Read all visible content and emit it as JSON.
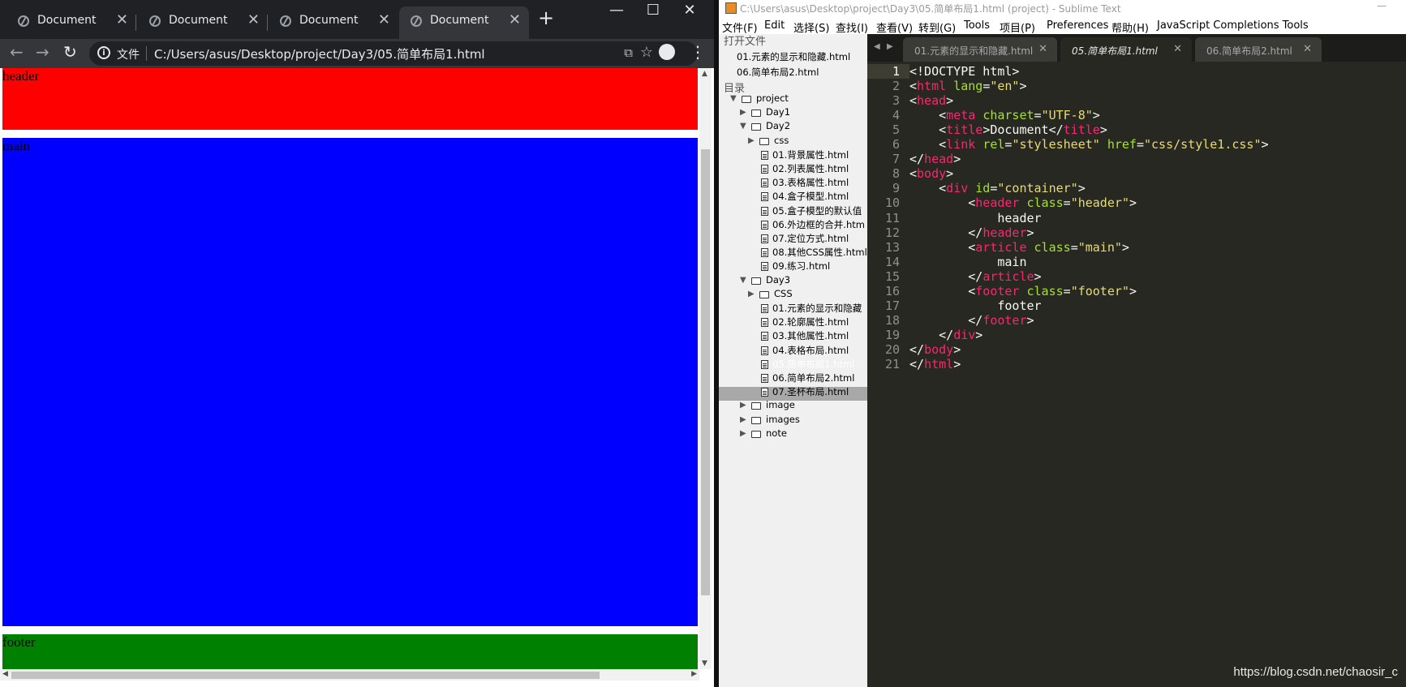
{
  "browser": {
    "tabs": [
      {
        "title": "Document",
        "active": false
      },
      {
        "title": "Document",
        "active": false
      },
      {
        "title": "Document",
        "active": false
      },
      {
        "title": "Document",
        "active": true
      }
    ],
    "address": {
      "label": "文件",
      "url": "C:/Users/asus/Desktop/project/Day3/05.简单布局1.html"
    },
    "page": {
      "header_text": "header",
      "main_text": "main",
      "footer_text": "footer",
      "colors": {
        "header": "#ff0000",
        "main": "#0000ff",
        "footer": "#008000"
      }
    }
  },
  "sublime": {
    "title": "C:\\Users\\asus\\Desktop\\project\\Day3\\05.简单布局1.html (project) - Sublime Text",
    "menu": [
      "文件(F)",
      "Edit",
      "选择(S)",
      "查找(I)",
      "查看(V)",
      "转到(G)",
      "Tools",
      "项目(P)",
      "Preferences",
      "帮助(H)",
      "JavaScript Completions Tools"
    ],
    "sidebar": {
      "open_files_heading": "打开文件",
      "open_files": [
        "01.元素的显示和隐藏.html",
        "06.简单布局2.html"
      ],
      "folders_heading": "目录",
      "tree": [
        {
          "label": "project",
          "type": "folder-open",
          "depth": 0
        },
        {
          "label": "Day1",
          "type": "folder",
          "depth": 1
        },
        {
          "label": "Day2",
          "type": "folder-open",
          "depth": 1
        },
        {
          "label": "css",
          "type": "folder",
          "depth": 2
        },
        {
          "label": "01.背景属性.html",
          "type": "file",
          "depth": 2
        },
        {
          "label": "02.列表属性.html",
          "type": "file",
          "depth": 2
        },
        {
          "label": "03.表格属性.html",
          "type": "file",
          "depth": 2
        },
        {
          "label": "04.盒子模型.html",
          "type": "file",
          "depth": 2
        },
        {
          "label": "05.盒子模型的默认值",
          "type": "file",
          "depth": 2
        },
        {
          "label": "06.外边框的合并.htm",
          "type": "file",
          "depth": 2
        },
        {
          "label": "07.定位方式.html",
          "type": "file",
          "depth": 2
        },
        {
          "label": "08.其他CSS属性.html",
          "type": "file",
          "depth": 2
        },
        {
          "label": "09.练习.html",
          "type": "file",
          "depth": 2
        },
        {
          "label": "Day3",
          "type": "folder-open",
          "depth": 1
        },
        {
          "label": "CSS",
          "type": "folder",
          "depth": 2
        },
        {
          "label": "01.元素的显示和隐藏",
          "type": "file",
          "depth": 2
        },
        {
          "label": "02.轮廓属性.html",
          "type": "file",
          "depth": 2
        },
        {
          "label": "03.其他属性.html",
          "type": "file",
          "depth": 2
        },
        {
          "label": "04.表格布局.html",
          "type": "file",
          "depth": 2
        },
        {
          "label": "05.简单布局1.html",
          "type": "file",
          "depth": 2,
          "selected": true
        },
        {
          "label": "06.简单布局2.html",
          "type": "file",
          "depth": 2
        },
        {
          "label": "07.圣杯布局.html",
          "type": "file",
          "depth": 2
        },
        {
          "label": "image",
          "type": "folder",
          "depth": 1
        },
        {
          "label": "images",
          "type": "folder",
          "depth": 1
        },
        {
          "label": "note",
          "type": "folder",
          "depth": 1
        }
      ]
    },
    "tabs": [
      {
        "title": "01.元素的显示和隐藏.html",
        "active": false
      },
      {
        "title": "05.简单布局1.html",
        "active": true
      },
      {
        "title": "06.简单布局2.html",
        "active": false
      }
    ],
    "current_line": 1,
    "code": [
      "<!DOCTYPE html>",
      "<html lang=\"en\">",
      "<head>",
      "    <meta charset=\"UTF-8\">",
      "    <title>Document</title>",
      "    <link rel=\"stylesheet\" href=\"css/style1.css\">",
      "</head>",
      "<body>",
      "    <div id=\"container\">",
      "        <header class=\"header\">",
      "            header",
      "        </header>",
      "        <article class=\"main\">",
      "            main",
      "        </article>",
      "        <footer class=\"footer\">",
      "            footer",
      "        </footer>",
      "    </div>",
      "</body>",
      "</html>"
    ]
  },
  "watermark": "https://blog.csdn.net/chaosir_c"
}
